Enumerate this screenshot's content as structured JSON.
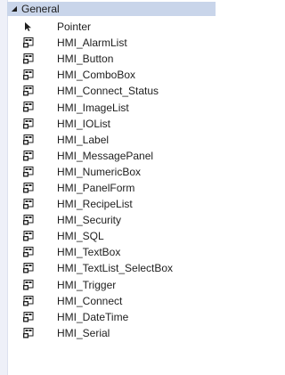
{
  "toolbox": {
    "group": {
      "label": "General",
      "expanded": true
    },
    "items": [
      {
        "label": "Pointer",
        "icon": "pointer-icon"
      },
      {
        "label": "HMI_AlarmList",
        "icon": "component-icon"
      },
      {
        "label": "HMI_Button",
        "icon": "component-icon"
      },
      {
        "label": "HMI_ComboBox",
        "icon": "component-icon"
      },
      {
        "label": "HMI_Connect_Status",
        "icon": "component-icon"
      },
      {
        "label": "HMI_ImageList",
        "icon": "component-icon"
      },
      {
        "label": "HMI_IOList",
        "icon": "component-icon"
      },
      {
        "label": "HMI_Label",
        "icon": "component-icon"
      },
      {
        "label": "HMI_MessagePanel",
        "icon": "component-icon"
      },
      {
        "label": "HMI_NumericBox",
        "icon": "component-icon"
      },
      {
        "label": "HMI_PanelForm",
        "icon": "component-icon"
      },
      {
        "label": "HMI_RecipeList",
        "icon": "component-icon"
      },
      {
        "label": "HMI_Security",
        "icon": "component-icon"
      },
      {
        "label": "HMI_SQL",
        "icon": "component-icon"
      },
      {
        "label": "HMI_TextBox",
        "icon": "component-icon"
      },
      {
        "label": "HMI_TextList_SelectBox",
        "icon": "component-icon"
      },
      {
        "label": "HMI_Trigger",
        "icon": "component-icon"
      },
      {
        "label": "HMI_Connect",
        "icon": "component-icon"
      },
      {
        "label": "HMI_DateTime",
        "icon": "component-icon"
      },
      {
        "label": "HMI_Serial",
        "icon": "component-icon"
      }
    ]
  },
  "colors": {
    "header_bg": "#c9d5ea",
    "strip_bg": "#eef0f8",
    "text": "#1e1e1e"
  }
}
